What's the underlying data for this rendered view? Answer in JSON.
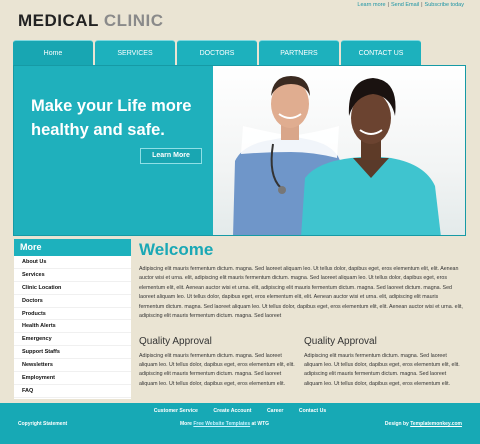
{
  "logo": {
    "part1": "MEDICAL",
    "part2": "CLINIC"
  },
  "top_links": [
    "Learn more",
    "Send Email",
    "Subscribe today"
  ],
  "nav": [
    "Home",
    "SERVICES",
    "DOCTORS",
    "PARTNERS",
    "CONTACT US"
  ],
  "hero": {
    "headline": "Make your Life more healthy and safe.",
    "button": "Learn More"
  },
  "sidebar": {
    "title": "More",
    "items": [
      "About Us",
      "Services",
      "Clinic Location",
      "Doctors",
      "Products",
      "Health Alerts",
      "Emergency",
      "Support Staffs",
      "Newsletters",
      "Employment",
      "FAQ"
    ]
  },
  "welcome": {
    "title": "Welcome",
    "body": "Adipiscing elit mauris fermentum dictum. magna. Sed laoreet aliquam leo. Ut tellus dolor, dapibus eget, eros elementum elit, elit. Aenean auctor wisi et urna. elit, adipiscing elit mauris fermentum dictum. magna. Sed laoreet aliquam leo. Ut tellus dolor, dapibus eget, eros elementum elit, elit. Aenean auctor wisi et urna. elit, adipiscing elit mauris fermentum dictum. magna. Sed laoreet dictum. magna. Sed laoreet aliquam leo. Ut tellus dolor, dapibus eget, eros elementum elit, elit. Aenean auctor wisi et urna. elit, adipiscing elit mauris fermentum dictum. magna. Sed laoreet aliquam leo. Ut tellus dolor, dapibus eget, eros elementum elit, elit. Aenean auctor wisi et urna. elit, adipiscing elit mauris fermentum dictum. magna. Sed laoreet"
  },
  "columns": [
    {
      "title": "Quality Approval",
      "body": "Adipiscing elit mauris fermentum dictum. magna. Sed laoreet aliquam leo. Ut tellus dolor, dapibus eget, eros elementum elit, elit. adipiscing elit mauris fermentum dictum. magna. Sed laoreet aliquam leo. Ut tellus dolor, dapibus eget, eros elementum elit."
    },
    {
      "title": "Quality Approval",
      "body": "Adipiscing elit mauris fermentum dictum. magna. Sed laoreet aliquam leo. Ut tellus dolor, dapibus eget, eros elementum elit, elit. adipiscing elit mauris fermentum dictum. magna. Sed laoreet aliquam leo. Ut tellus dolor, dapibus eget, eros elementum elit."
    }
  ],
  "footer": {
    "links": [
      "Customer Service",
      "Create Account",
      "Career",
      "Contact Us"
    ],
    "copyright": "Copyright Statement",
    "more_prefix": "More",
    "more_link": "Free Website Templates",
    "more_suffix": "at WTG",
    "design_prefix": "Design by",
    "design_link": "Templatemonkey.com"
  }
}
